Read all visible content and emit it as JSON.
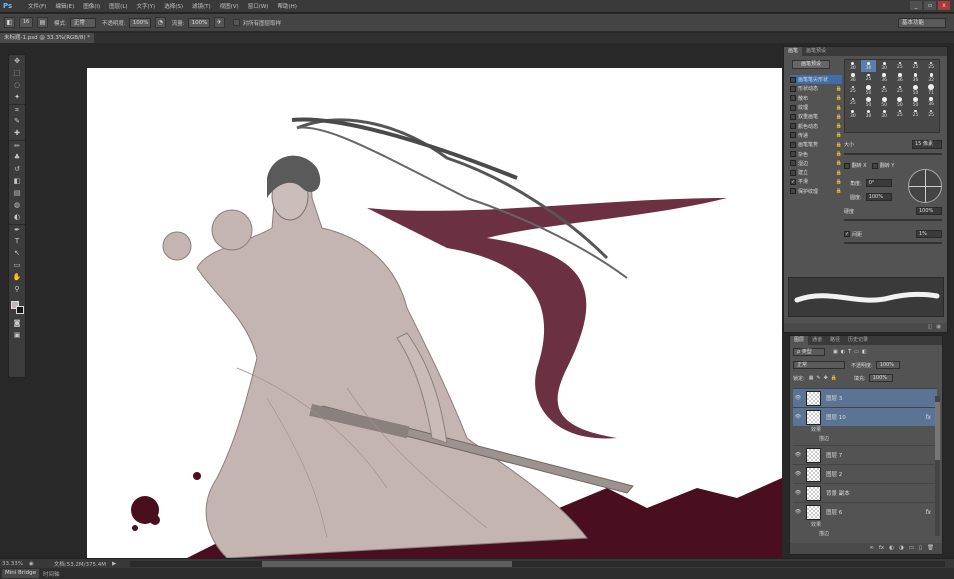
{
  "app": {
    "logo": "Ps"
  },
  "menu": [
    "文件(F)",
    "编辑(E)",
    "图像(I)",
    "图层(L)",
    "文字(Y)",
    "选择(S)",
    "滤镜(T)",
    "视图(V)",
    "窗口(W)",
    "帮助(H)"
  ],
  "window_controls": [
    "_",
    "▫",
    "x"
  ],
  "options": {
    "brush_size": "16",
    "mode_label": "模式:",
    "mode_value": "正常",
    "opacity_label": "不透明度:",
    "opacity_value": "100%",
    "flow_label": "流量:",
    "flow_value": "100%",
    "sample_label": "对所有图层取样",
    "workspace": "基本功能"
  },
  "document": {
    "tab": "未标题-1.psd @ 33.3%(RGB/8) *"
  },
  "tools": [
    "move-icon",
    "marquee-icon",
    "lasso-icon",
    "quick-select-icon",
    "crop-icon",
    "eyedropper-icon",
    "healing-icon",
    "brush-icon",
    "stamp-icon",
    "history-brush-icon",
    "eraser-icon",
    "gradient-icon",
    "blur-icon",
    "dodge-icon",
    "pen-icon",
    "type-icon",
    "path-select-icon",
    "shape-icon",
    "hand-icon",
    "zoom-icon"
  ],
  "tool_glyphs": [
    "✥",
    "⬚",
    "◌",
    "✦",
    "⌗",
    "✎",
    "✚",
    "✏",
    "♣",
    "↺",
    "◧",
    "▤",
    "◍",
    "◐",
    "✒",
    "T",
    "↖",
    "▭",
    "✋",
    "⚲"
  ],
  "colors": {
    "foreground": "#c4b5b2",
    "background": "#1a1a1a",
    "accent_red": "#4a0f1f",
    "selection": "#5b7394"
  },
  "brush_panel": {
    "tabs": [
      "画笔",
      "画笔预设"
    ],
    "presets_button": "画笔预设",
    "options": [
      {
        "label": "画笔笔尖形状",
        "checked": false,
        "active": true
      },
      {
        "label": "形状动态",
        "checked": false
      },
      {
        "label": "散布",
        "checked": false
      },
      {
        "label": "纹理",
        "checked": false
      },
      {
        "label": "双重画笔",
        "checked": false
      },
      {
        "label": "颜色动态",
        "checked": false
      },
      {
        "label": "传递",
        "checked": false
      },
      {
        "label": "画笔笔势",
        "checked": false
      },
      {
        "label": "杂色",
        "checked": false
      },
      {
        "label": "湿边",
        "checked": false
      },
      {
        "label": "建立",
        "checked": false
      },
      {
        "label": "平滑",
        "checked": true
      },
      {
        "label": "保护纹理",
        "checked": false
      }
    ],
    "tips": [
      "30",
      "30",
      "30",
      "25",
      "25",
      "25",
      "36",
      "25",
      "36",
      "36",
      "36",
      "32",
      "25",
      "50",
      "25",
      "25",
      "50",
      "71",
      "25",
      "50",
      "50",
      "50",
      "50",
      "36",
      "30",
      "30",
      "30",
      "25",
      "25",
      "25"
    ],
    "size_label": "大小",
    "size_value": "15 像素",
    "flip_x": "翻转 X",
    "flip_y": "翻转 Y",
    "angle_label": "角度:",
    "angle_value": "0°",
    "roundness_label": "圆度:",
    "roundness_value": "100%",
    "hardness_label": "硬度",
    "hardness_value": "100%",
    "spacing_label": "间距",
    "spacing_value": "1%"
  },
  "layers_panel": {
    "tabs": [
      "图层",
      "通道",
      "路径",
      "历史记录"
    ],
    "filter": "ρ 类型",
    "blend_mode": "正常",
    "opacity_label": "不透明度:",
    "opacity_value": "100%",
    "lock_label": "锁定:",
    "fill_label": "填充:",
    "fill_value": "100%",
    "layers": [
      {
        "name": "图层 3",
        "selected": true,
        "fx": false
      },
      {
        "name": "图层 10",
        "selected": true,
        "fx": true
      },
      {
        "name": "图层 7",
        "selected": false,
        "fx": false
      },
      {
        "name": "图层 2",
        "selected": false,
        "fx": false
      },
      {
        "name": "背景 副本",
        "selected": false,
        "fx": false
      },
      {
        "name": "图层 6",
        "selected": false,
        "fx": true
      }
    ],
    "effects_label": "效果",
    "effect_item": "描边",
    "bottom_icons": [
      "∞",
      "fx",
      "◐",
      "◑",
      "▭",
      "▯",
      "🗑"
    ]
  },
  "status": {
    "zoom": "33.33%",
    "doc_size": "文档:53.2M/375.4M",
    "mini_bridge": "Mini Bridge",
    "timeline": "时间轴"
  }
}
